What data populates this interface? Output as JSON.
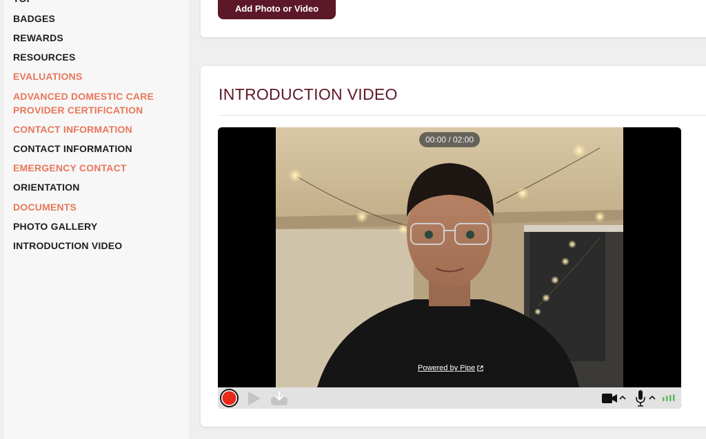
{
  "sidebar": {
    "items": [
      {
        "label": "TOP",
        "color": "dark"
      },
      {
        "label": "BADGES",
        "color": "dark"
      },
      {
        "label": "REWARDS",
        "color": "dark"
      },
      {
        "label": "RESOURCES",
        "color": "dark"
      },
      {
        "label": "EVALUATIONS",
        "color": "orange"
      },
      {
        "label": "ADVANCED DOMESTIC CARE PROVIDER CERTIFICATION",
        "color": "orange"
      },
      {
        "label": "CONTACT INFORMATION",
        "color": "orange"
      },
      {
        "label": "CONTACT INFORMATION",
        "color": "dark"
      },
      {
        "label": "EMERGENCY CONTACT",
        "color": "orange"
      },
      {
        "label": "ORIENTATION",
        "color": "dark"
      },
      {
        "label": "DOCUMENTS",
        "color": "orange"
      },
      {
        "label": "PHOTO GALLERY",
        "color": "dark"
      },
      {
        "label": "INTRODUCTION VIDEO",
        "color": "dark"
      }
    ]
  },
  "photo_section": {
    "add_button_label": "Add Photo or Video"
  },
  "intro_video": {
    "title": "INTRODUCTION VIDEO",
    "timer": "00:00 / 02:00",
    "powered_by": "Powered by Pipe",
    "controls": {
      "record": "record-button",
      "play": "play-button",
      "download": "download-button",
      "camera": "camera-icon",
      "microphone": "microphone-icon"
    }
  },
  "colors": {
    "accent": "#5c1728",
    "orange_link": "#e9765a",
    "record_red": "#e8291b",
    "level_green": "#5cb85c"
  }
}
